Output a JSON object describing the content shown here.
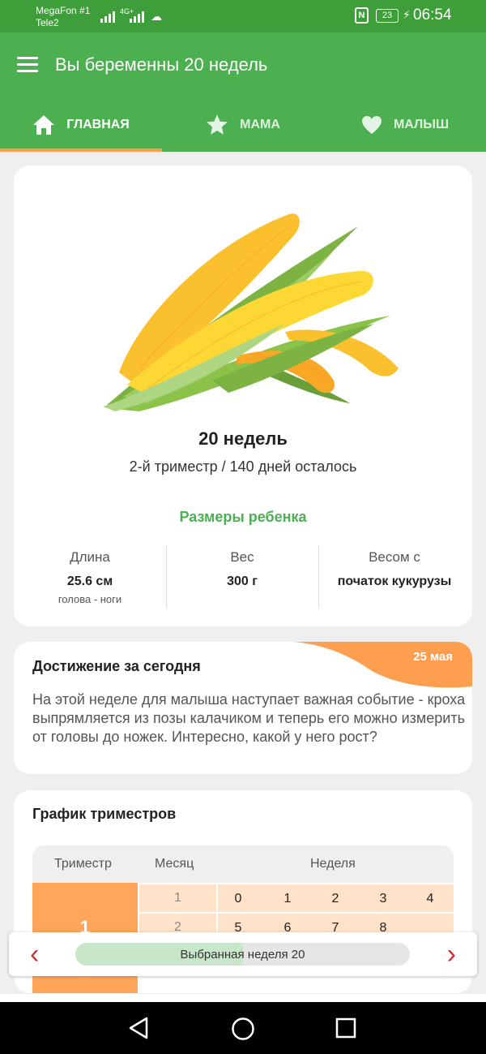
{
  "status_bar": {
    "carrier1": "MegaFon #1",
    "carrier2": "Tele2",
    "network": "4G+",
    "nfc": "N",
    "battery": "23",
    "time": "06:54"
  },
  "app_bar": {
    "title": "Вы беременны 20 недель"
  },
  "tabs": [
    {
      "label": "ГЛАВНАЯ",
      "icon": "home-icon",
      "active": true
    },
    {
      "label": "МАМА",
      "icon": "star-icon",
      "active": false
    },
    {
      "label": "МАЛЫШ",
      "icon": "heart-icon",
      "active": false
    }
  ],
  "week_card": {
    "image": "corn-image",
    "title": "20 недель",
    "subtitle": "2-й триместр / 140 дней осталось",
    "sizes_title": "Размеры ребенка",
    "stats": [
      {
        "label": "Длина",
        "value": "25.6 см",
        "note": "голова - ноги"
      },
      {
        "label": "Вес",
        "value": "300 г",
        "note": ""
      },
      {
        "label": "Весом с",
        "value": "початок кукурузы",
        "note": ""
      }
    ]
  },
  "achievement": {
    "title": "Достижение за сегодня",
    "date": "25 мая",
    "text": "На этой неделе для малыша наступает важная событие - кроха выпрямляется из позы калачиком и теперь его можно измерить от головы до ножек. Интересно, какой у него рост?"
  },
  "trimester_chart": {
    "title": "График триместров",
    "headers": [
      "Триместр",
      "Месяц",
      "Неделя"
    ],
    "trimester": "1",
    "rows": [
      {
        "month": "1",
        "weeks": [
          "0",
          "1",
          "2",
          "3",
          "4"
        ]
      },
      {
        "month": "2",
        "weeks": [
          "5",
          "6",
          "7",
          "8",
          ""
        ]
      }
    ]
  },
  "week_selector": {
    "label": "Выбранная неделя 20",
    "progress": 0.5,
    "prev": "‹",
    "next": "›"
  },
  "colors": {
    "primary": "#4caf50",
    "status_bar": "#3e9e3a",
    "accent": "#ff9e4f",
    "arrow": "#d32f2f"
  }
}
